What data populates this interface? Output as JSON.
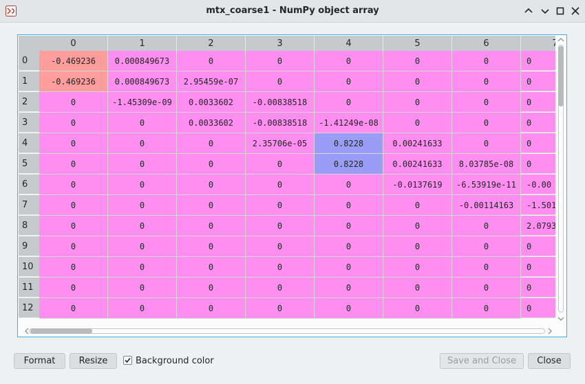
{
  "window": {
    "title": "mtx_coarse1 - NumPy object array"
  },
  "colors": {
    "cell_bg": "#ff8ef0",
    "cell_low": "#ff9c9c",
    "cell_high": "#9b9cf5",
    "accent": "#3daee9"
  },
  "columns": [
    "0",
    "1",
    "2",
    "3",
    "4",
    "5",
    "6",
    "7"
  ],
  "rows": [
    {
      "label": "0",
      "cells": [
        "-0.469236",
        "0.000849673",
        "0",
        "0",
        "0",
        "0",
        "0",
        "0"
      ]
    },
    {
      "label": "1",
      "cells": [
        "-0.469236",
        "0.000849673",
        "2.95459e-07",
        "0",
        "0",
        "0",
        "0",
        "0"
      ]
    },
    {
      "label": "2",
      "cells": [
        "0",
        "-1.45309e-09",
        "0.0033602",
        "-0.00838518",
        "0",
        "0",
        "0",
        "0"
      ]
    },
    {
      "label": "3",
      "cells": [
        "0",
        "0",
        "0.0033602",
        "-0.00838518",
        "-1.41249e-08",
        "0",
        "0",
        "0"
      ]
    },
    {
      "label": "4",
      "cells": [
        "0",
        "0",
        "0",
        "2.35706e-05",
        "0.8228",
        "0.00241633",
        "0",
        "0"
      ]
    },
    {
      "label": "5",
      "cells": [
        "0",
        "0",
        "0",
        "0",
        "0.8228",
        "0.00241633",
        "8.03785e-08",
        "0"
      ]
    },
    {
      "label": "6",
      "cells": [
        "0",
        "0",
        "0",
        "0",
        "0",
        "-0.0137619",
        "-6.53919e-11",
        "-0.00"
      ]
    },
    {
      "label": "7",
      "cells": [
        "0",
        "0",
        "0",
        "0",
        "0",
        "0",
        "-0.00114163",
        "-1.501"
      ]
    },
    {
      "label": "8",
      "cells": [
        "0",
        "0",
        "0",
        "0",
        "0",
        "0",
        "0",
        "2.0793"
      ]
    },
    {
      "label": "9",
      "cells": [
        "0",
        "0",
        "0",
        "0",
        "0",
        "0",
        "0",
        "0"
      ]
    },
    {
      "label": "10",
      "cells": [
        "0",
        "0",
        "0",
        "0",
        "0",
        "0",
        "0",
        "0"
      ]
    },
    {
      "label": "11",
      "cells": [
        "0",
        "0",
        "0",
        "0",
        "0",
        "0",
        "0",
        "0"
      ]
    },
    {
      "label": "12",
      "cells": [
        "0",
        "0",
        "0",
        "0",
        "0",
        "0",
        "0",
        "0"
      ]
    }
  ],
  "buttons": {
    "format": "Format",
    "resize": "Resize",
    "save_close": "Save and Close",
    "close": "Close"
  },
  "background_color": {
    "label": "Background color",
    "checked": true
  }
}
